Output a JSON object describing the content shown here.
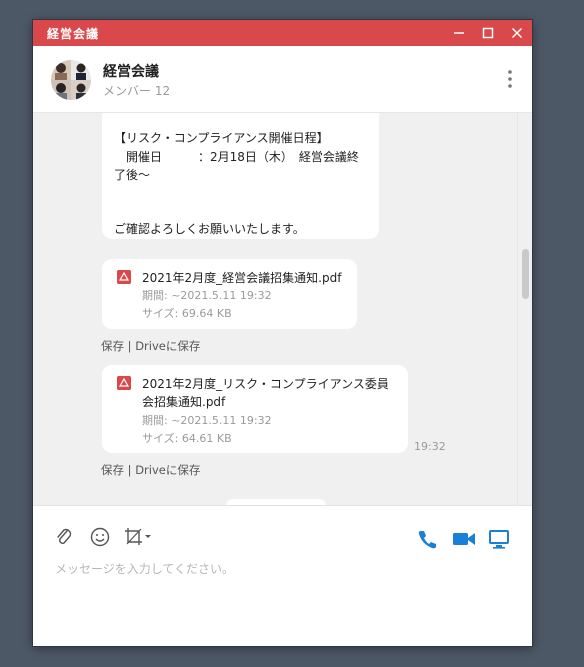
{
  "window": {
    "title": "経営会議"
  },
  "header": {
    "chat_name": "経営会議",
    "members": "メンバー 12"
  },
  "messages": {
    "text_lines": [
      "【リスク・コンプライアンス開催日程】",
      "　開催日　　　：2月18日（木）　経営会議終",
      "了後～",
      "ご確認よろしくお願いいたします。"
    ],
    "files": [
      {
        "name_lines": [
          "2021年2月度_経営会議招集通知.pdf"
        ],
        "expiry": "期間: ~2021.5.11 19:32",
        "size": "サイズ: 69.64 KB",
        "save": "保存",
        "separator": "|",
        "drive_save": "Driveに保存"
      },
      {
        "name_lines": [
          "2021年2月度_リスク・コンプライアンス委員",
          "会招集通知.pdf"
        ],
        "expiry": "期間: ~2021.5.11 19:32",
        "size": "サイズ: 64.61 KB",
        "save": "保存",
        "separator": "|",
        "drive_save": "Driveに保存"
      }
    ],
    "time": "19:32"
  },
  "composer": {
    "placeholder": "メッセージを入力してください。",
    "icons": [
      "paperclip-icon",
      "emoji-icon",
      "crop-icon",
      "phone-icon",
      "video-icon",
      "screen-share-icon"
    ]
  },
  "colors": {
    "titlebar": "#d9484a",
    "accent_blue": "#1a7fd6",
    "background": "#4d5866",
    "chat_bg": "#f0f0f0"
  }
}
